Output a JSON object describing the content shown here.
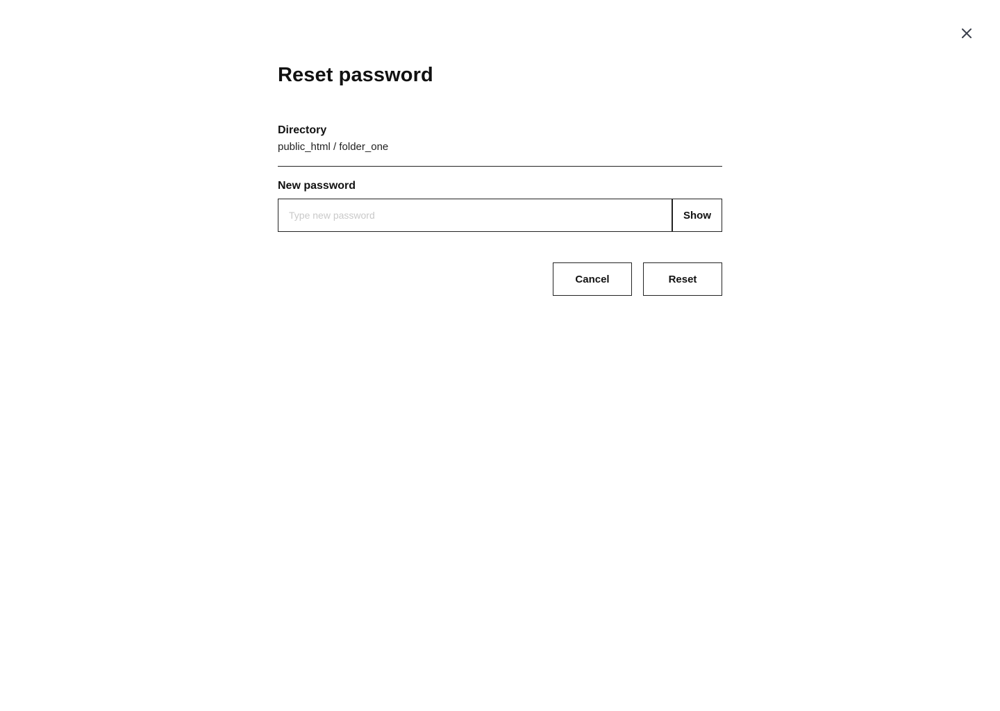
{
  "dialog": {
    "title": "Reset password",
    "close_icon": "close-icon",
    "directory": {
      "label": "Directory",
      "value": "public_html / folder_one"
    },
    "new_password": {
      "label": "New password",
      "value": "",
      "placeholder": "Type new password",
      "show_label": "Show"
    },
    "actions": {
      "cancel_label": "Cancel",
      "reset_label": "Reset"
    }
  },
  "colors": {
    "background": "#ffffff",
    "text": "#111111",
    "border": "#222222",
    "placeholder": "#c9c9c9",
    "close_icon": "#3a3f4b"
  }
}
